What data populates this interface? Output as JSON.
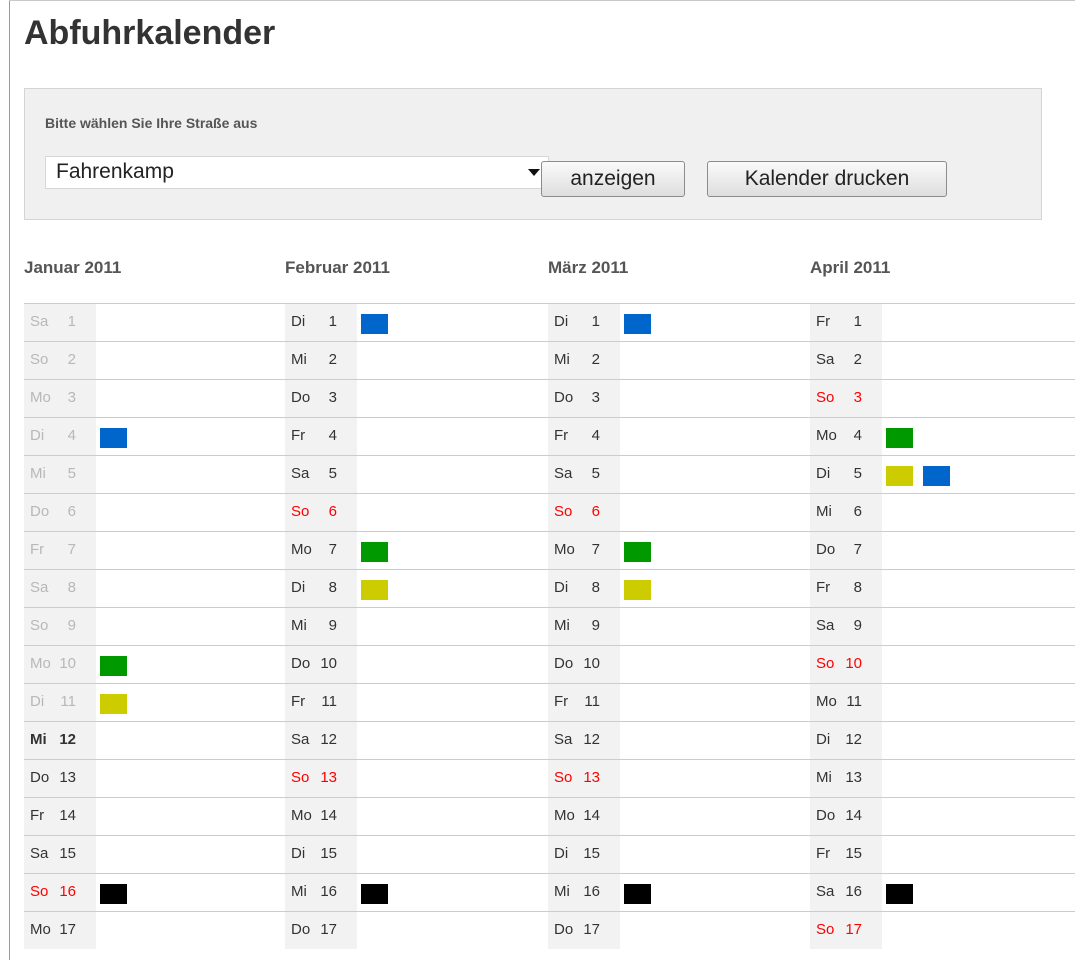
{
  "page": {
    "title": "Abfuhrkalender"
  },
  "filter": {
    "label": "Bitte wählen Sie Ihre Straße aus",
    "street_selected": "Fahrenkamp",
    "show_button": "anzeigen",
    "print_button": "Kalender drucken"
  },
  "colors": {
    "blue": "#0066cc",
    "green": "#009900",
    "yellow": "#cccc00",
    "black": "#000000",
    "sunday_text": "#ff0000",
    "past_text": "#b8b8b8"
  },
  "months": [
    {
      "title": "Januar 2011",
      "days": [
        {
          "wd": "Sa",
          "d": "1",
          "state": "past",
          "marks": []
        },
        {
          "wd": "So",
          "d": "2",
          "state": "past",
          "marks": []
        },
        {
          "wd": "Mo",
          "d": "3",
          "state": "past",
          "marks": []
        },
        {
          "wd": "Di",
          "d": "4",
          "state": "past",
          "marks": [
            "blue"
          ]
        },
        {
          "wd": "Mi",
          "d": "5",
          "state": "past",
          "marks": []
        },
        {
          "wd": "Do",
          "d": "6",
          "state": "past",
          "marks": []
        },
        {
          "wd": "Fr",
          "d": "7",
          "state": "past",
          "marks": []
        },
        {
          "wd": "Sa",
          "d": "8",
          "state": "past",
          "marks": []
        },
        {
          "wd": "So",
          "d": "9",
          "state": "past",
          "marks": []
        },
        {
          "wd": "Mo",
          "d": "10",
          "state": "past",
          "marks": [
            "green"
          ]
        },
        {
          "wd": "Di",
          "d": "11",
          "state": "past",
          "marks": [
            "yellow"
          ]
        },
        {
          "wd": "Mi",
          "d": "12",
          "state": "today",
          "marks": []
        },
        {
          "wd": "Do",
          "d": "13",
          "state": "normal",
          "marks": []
        },
        {
          "wd": "Fr",
          "d": "14",
          "state": "normal",
          "marks": []
        },
        {
          "wd": "Sa",
          "d": "15",
          "state": "normal",
          "marks": []
        },
        {
          "wd": "So",
          "d": "16",
          "state": "sunday",
          "marks": [
            "black"
          ]
        },
        {
          "wd": "Mo",
          "d": "17",
          "state": "normal",
          "marks": []
        }
      ]
    },
    {
      "title": "Februar 2011",
      "days": [
        {
          "wd": "Di",
          "d": "1",
          "state": "normal",
          "marks": [
            "blue"
          ]
        },
        {
          "wd": "Mi",
          "d": "2",
          "state": "normal",
          "marks": []
        },
        {
          "wd": "Do",
          "d": "3",
          "state": "normal",
          "marks": []
        },
        {
          "wd": "Fr",
          "d": "4",
          "state": "normal",
          "marks": []
        },
        {
          "wd": "Sa",
          "d": "5",
          "state": "normal",
          "marks": []
        },
        {
          "wd": "So",
          "d": "6",
          "state": "sunday",
          "marks": []
        },
        {
          "wd": "Mo",
          "d": "7",
          "state": "normal",
          "marks": [
            "green"
          ]
        },
        {
          "wd": "Di",
          "d": "8",
          "state": "normal",
          "marks": [
            "yellow"
          ]
        },
        {
          "wd": "Mi",
          "d": "9",
          "state": "normal",
          "marks": []
        },
        {
          "wd": "Do",
          "d": "10",
          "state": "normal",
          "marks": []
        },
        {
          "wd": "Fr",
          "d": "11",
          "state": "normal",
          "marks": []
        },
        {
          "wd": "Sa",
          "d": "12",
          "state": "normal",
          "marks": []
        },
        {
          "wd": "So",
          "d": "13",
          "state": "sunday",
          "marks": []
        },
        {
          "wd": "Mo",
          "d": "14",
          "state": "normal",
          "marks": []
        },
        {
          "wd": "Di",
          "d": "15",
          "state": "normal",
          "marks": []
        },
        {
          "wd": "Mi",
          "d": "16",
          "state": "normal",
          "marks": [
            "black"
          ]
        },
        {
          "wd": "Do",
          "d": "17",
          "state": "normal",
          "marks": []
        }
      ]
    },
    {
      "title": "März 2011",
      "days": [
        {
          "wd": "Di",
          "d": "1",
          "state": "normal",
          "marks": [
            "blue"
          ]
        },
        {
          "wd": "Mi",
          "d": "2",
          "state": "normal",
          "marks": []
        },
        {
          "wd": "Do",
          "d": "3",
          "state": "normal",
          "marks": []
        },
        {
          "wd": "Fr",
          "d": "4",
          "state": "normal",
          "marks": []
        },
        {
          "wd": "Sa",
          "d": "5",
          "state": "normal",
          "marks": []
        },
        {
          "wd": "So",
          "d": "6",
          "state": "sunday",
          "marks": []
        },
        {
          "wd": "Mo",
          "d": "7",
          "state": "normal",
          "marks": [
            "green"
          ]
        },
        {
          "wd": "Di",
          "d": "8",
          "state": "normal",
          "marks": [
            "yellow"
          ]
        },
        {
          "wd": "Mi",
          "d": "9",
          "state": "normal",
          "marks": []
        },
        {
          "wd": "Do",
          "d": "10",
          "state": "normal",
          "marks": []
        },
        {
          "wd": "Fr",
          "d": "11",
          "state": "normal",
          "marks": []
        },
        {
          "wd": "Sa",
          "d": "12",
          "state": "normal",
          "marks": []
        },
        {
          "wd": "So",
          "d": "13",
          "state": "sunday",
          "marks": []
        },
        {
          "wd": "Mo",
          "d": "14",
          "state": "normal",
          "marks": []
        },
        {
          "wd": "Di",
          "d": "15",
          "state": "normal",
          "marks": []
        },
        {
          "wd": "Mi",
          "d": "16",
          "state": "normal",
          "marks": [
            "black"
          ]
        },
        {
          "wd": "Do",
          "d": "17",
          "state": "normal",
          "marks": []
        }
      ]
    },
    {
      "title": "April 2011",
      "days": [
        {
          "wd": "Fr",
          "d": "1",
          "state": "normal",
          "marks": []
        },
        {
          "wd": "Sa",
          "d": "2",
          "state": "normal",
          "marks": []
        },
        {
          "wd": "So",
          "d": "3",
          "state": "sunday",
          "marks": []
        },
        {
          "wd": "Mo",
          "d": "4",
          "state": "normal",
          "marks": [
            "green"
          ]
        },
        {
          "wd": "Di",
          "d": "5",
          "state": "normal",
          "marks": [
            "yellow",
            "blue"
          ]
        },
        {
          "wd": "Mi",
          "d": "6",
          "state": "normal",
          "marks": []
        },
        {
          "wd": "Do",
          "d": "7",
          "state": "normal",
          "marks": []
        },
        {
          "wd": "Fr",
          "d": "8",
          "state": "normal",
          "marks": []
        },
        {
          "wd": "Sa",
          "d": "9",
          "state": "normal",
          "marks": []
        },
        {
          "wd": "So",
          "d": "10",
          "state": "sunday",
          "marks": []
        },
        {
          "wd": "Mo",
          "d": "11",
          "state": "normal",
          "marks": []
        },
        {
          "wd": "Di",
          "d": "12",
          "state": "normal",
          "marks": []
        },
        {
          "wd": "Mi",
          "d": "13",
          "state": "normal",
          "marks": []
        },
        {
          "wd": "Do",
          "d": "14",
          "state": "normal",
          "marks": []
        },
        {
          "wd": "Fr",
          "d": "15",
          "state": "normal",
          "marks": []
        },
        {
          "wd": "Sa",
          "d": "16",
          "state": "normal",
          "marks": [
            "black"
          ]
        },
        {
          "wd": "So",
          "d": "17",
          "state": "sunday",
          "marks": []
        }
      ]
    }
  ]
}
